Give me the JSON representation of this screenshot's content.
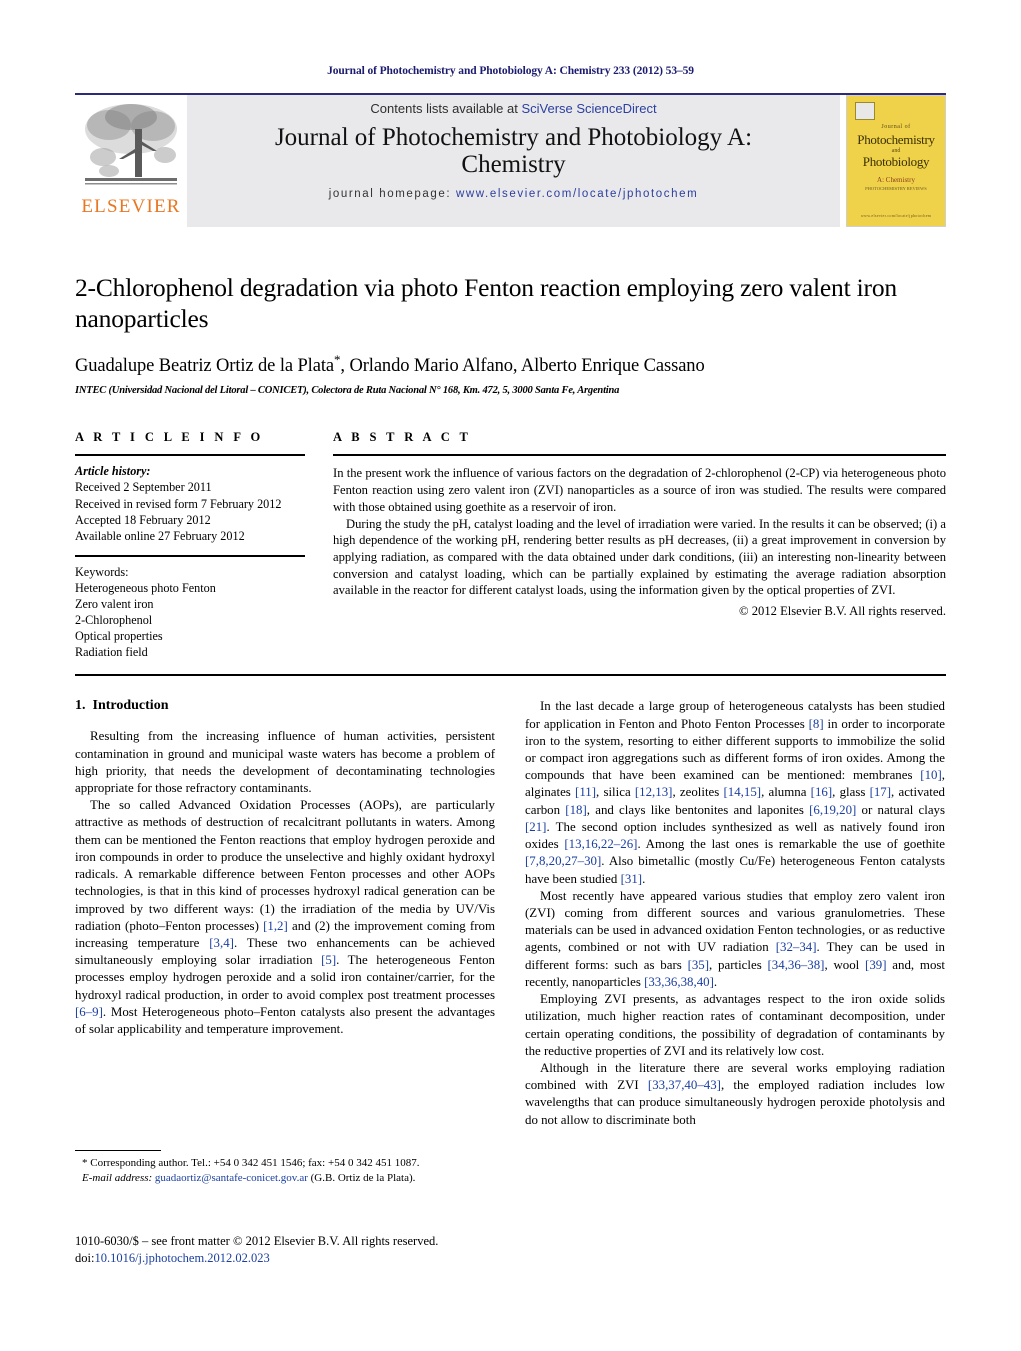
{
  "running_head": "Journal of Photochemistry and Photobiology A: Chemistry 233 (2012) 53–59",
  "masthead": {
    "contents_prefix": "Contents lists available at ",
    "sciencedirect_link": "SciVerse ScienceDirect",
    "journal_title_line1": "Journal of Photochemistry and Photobiology A:",
    "journal_title_line2": "Chemistry",
    "homepage_prefix": "journal homepage: ",
    "homepage_url": "www.elsevier.com/locate/jphotochem",
    "publisher_wordmark": "ELSEVIER",
    "cover": {
      "journal_of": "Journal of",
      "line1": "Photochemistry",
      "and": "and",
      "line2": "Photobiology",
      "subtitle": "A: Chemistry",
      "subtitle2": "PHOTOCHEMISTRY REVIEWS",
      "footer": "www.elsevier.com/locate/jphotochem"
    }
  },
  "article": {
    "title": "2-Chlorophenol degradation via photo Fenton reaction employing zero valent iron nanoparticles",
    "authors": "Guadalupe Beatriz Ortiz de la Plata",
    "authors_rest": ", Orlando Mario Alfano, Alberto Enrique Cassano",
    "corresponding_marker": "*",
    "affiliation": "INTEC (Universidad Nacional del Litoral – CONICET), Colectora de Ruta Nacional N° 168, Km. 472, 5, 3000 Santa Fe, Argentina"
  },
  "article_info": {
    "heading": "A R T I C L E   I N F O",
    "history_label": "Article history:",
    "history": [
      "Received 2 September 2011",
      "Received in revised form 7 February 2012",
      "Accepted 18 February 2012",
      "Available online 27 February 2012"
    ],
    "keywords_label": "Keywords:",
    "keywords": [
      "Heterogeneous photo Fenton",
      "Zero valent iron",
      "2-Chlorophenol",
      "Optical properties",
      "Radiation field"
    ]
  },
  "abstract": {
    "heading": "A B S T R A C T",
    "paragraph1": "In the present work the influence of various factors on the degradation of 2-chlorophenol (2-CP) via heterogeneous photo Fenton reaction using zero valent iron (ZVI) nanoparticles as a source of iron was studied. The results were compared with those obtained using goethite as a reservoir of iron.",
    "paragraph2": "During the study the pH, catalyst loading and the level of irradiation were varied. In the results it can be observed; (i) a high dependence of the working pH, rendering better results as pH decreases, (ii) a great improvement in conversion by applying radiation, as compared with the data obtained under dark conditions, (iii) an interesting non-linearity between conversion and catalyst loading, which can be partially explained by estimating the average radiation absorption available in the reactor for different catalyst loads, using the information given by the optical properties of ZVI.",
    "copyright": "© 2012 Elsevier B.V. All rights reserved."
  },
  "introduction": {
    "number": "1.",
    "heading": "Introduction",
    "left_paragraphs": [
      "Resulting from the increasing influence of human activities, persistent contamination in ground and municipal waste waters has become a problem of high priority, that needs the development of decontaminating technologies appropriate for those refractory contaminants."
    ]
  },
  "footnote": {
    "line1": "* Corresponding author. Tel.: +54 0 342 451 1546; fax: +54 0 342 451 1087.",
    "email_label": "E-mail address:",
    "email": "guadaortiz@santafe-conicet.gov.ar",
    "email_suffix": "(G.B. Ortiz de la Plata)."
  },
  "bottom_matter": {
    "line1": "1010-6030/$ – see front matter © 2012 Elsevier B.V. All rights reserved.",
    "doi_label": "doi:",
    "doi_value": "10.1016/j.jphotochem.2012.02.023"
  },
  "colors": {
    "runhead_blue": "#1b1b6f",
    "link_blue": "#2b3f9e",
    "reference_blue": "#1b3fa0",
    "elsevier_orange": "#E87722",
    "band_grey": "#e9e9ec",
    "cover_yellow": "#f0d24a"
  }
}
